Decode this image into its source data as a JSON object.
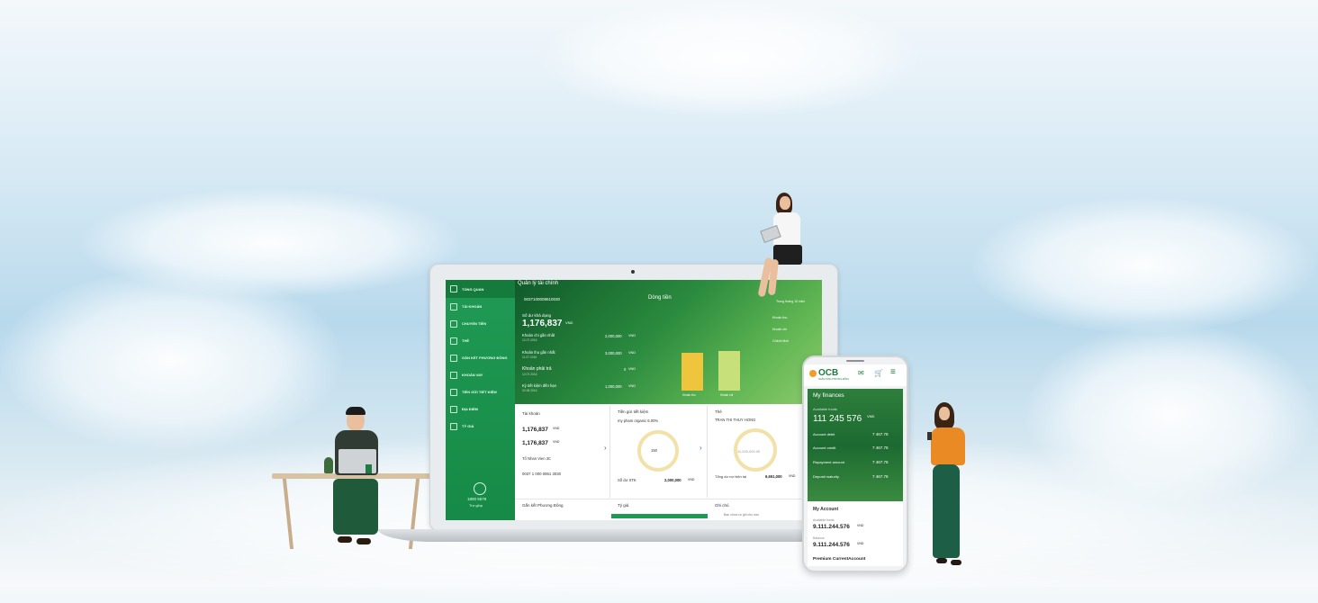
{
  "laptop": {
    "sidebar": {
      "items": [
        "TỔNG QUAN",
        "TÀI KHOẢN",
        "CHUYỂN TIỀN",
        "THẺ",
        "GẮN KẾT PHƯƠNG ĐÔNG",
        "KHOẢN VAY",
        "TIỀN GỬI TIẾT KIỆM",
        "ĐỊA ĐIỂM",
        "TỶ GIÁ"
      ],
      "hotline": "1800 6678",
      "hotline_note": "Trợ giúp"
    },
    "hero": {
      "title": "Quản lý tài chính",
      "account_no": "0037100008610030",
      "available_label": "Số dư khả dụng",
      "available_amount": "1,176,837",
      "currency": "VND",
      "rows": [
        {
          "label": "Khoản chi gần nhất",
          "date": "12.07.2016",
          "amount": "2,000,000"
        },
        {
          "label": "Khoản thu gần nhất",
          "date": "11.07.2016",
          "amount": "3,000,000"
        },
        {
          "label": "Khoản phải trả",
          "date": "12.07.2016",
          "amount": "0"
        },
        {
          "label": "Kỳ tiết kiệm đến hạn",
          "date": "02.08.2016",
          "amount": "1,000,000"
        }
      ],
      "cashflow_title": "Dòng tiền",
      "cashflow_link": "Trong tháng 10 năm",
      "legend": [
        "Khoản thu",
        "Khoản chi",
        "Chênh lệch"
      ],
      "bar_labels": [
        "Khoản thu",
        "Khoản chi"
      ]
    },
    "cards": {
      "account": {
        "title": "Tài khoản",
        "amount1": "1,176,837",
        "amount2": "1,176,837",
        "currency": "VND",
        "holder": "Tổ Nhan Vien 3C",
        "number": "0037 1 000 0861 3030"
      },
      "savings": {
        "title": "Tiền gửi tiết kiệm",
        "product": "my pham organic  6.00%",
        "center": "150",
        "total_label": "Số dư STK",
        "total_value": "2,000,000",
        "currency": "VND"
      },
      "card": {
        "title": "Thẻ",
        "holder": "TRAN THI THUY HONG",
        "center": "11,000,000.00",
        "total_label": "Tổng dư nợ hiện tại",
        "total_value": "6,651,000",
        "currency": "VND"
      }
    },
    "bottom": [
      "Gắn kết Phương Đông",
      "Tỷ giá",
      "Ghi chú"
    ],
    "bottom_note": "Bạn chưa có ghi chú nào"
  },
  "phone": {
    "brand": "OCB",
    "brand_sub": "NGÂN HÀNG PHƯƠNG ĐÔNG",
    "section": "My finances",
    "balance_label": "Available funds",
    "balance": "111 245 576",
    "currency": "VND",
    "rows": [
      {
        "label": "Account debit",
        "value": "7 467.78"
      },
      {
        "label": "Account credit",
        "value": "7 467.78"
      },
      {
        "label": "Repayment amount",
        "value": "7 467.78"
      },
      {
        "label": "Deposit maturity",
        "value": "7 467.78"
      }
    ],
    "account_title": "My Account",
    "avail_label": "Available funds",
    "avail_value": "9.111.244.576",
    "bal_label": "Balance",
    "bal_value": "9.111.244.576",
    "product": "Premium CurrentAccount"
  }
}
